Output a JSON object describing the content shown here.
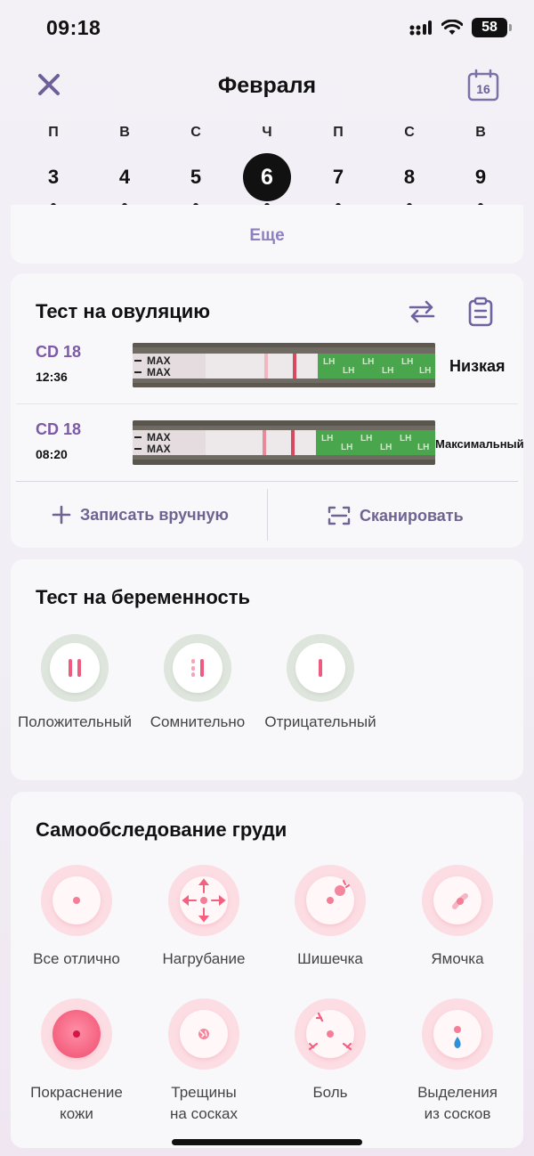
{
  "status_bar": {
    "time": "09:18",
    "battery": "58"
  },
  "header": {
    "month": "Февраля",
    "calendar_day": "16"
  },
  "week": {
    "days": [
      {
        "weekday": "П",
        "date": "3",
        "selected": false
      },
      {
        "weekday": "В",
        "date": "4",
        "selected": false
      },
      {
        "weekday": "С",
        "date": "5",
        "selected": false
      },
      {
        "weekday": "Ч",
        "date": "6",
        "selected": true
      },
      {
        "weekday": "П",
        "date": "7",
        "selected": false
      },
      {
        "weekday": "С",
        "date": "8",
        "selected": false
      },
      {
        "weekday": "В",
        "date": "9",
        "selected": false
      }
    ]
  },
  "more": {
    "label": "Еще"
  },
  "ovulation": {
    "title": "Тест на овуляцию",
    "tests": [
      {
        "cd": "CD 18",
        "time": "12:36",
        "result": "Низкая",
        "strip_text": "MAX"
      },
      {
        "cd": "CD 18",
        "time": "08:20",
        "result": "Максимальный",
        "strip_text": "MAX"
      }
    ],
    "manual_label": "Записать вручную",
    "scan_label": "Сканировать"
  },
  "pregnancy": {
    "title": "Тест на беременность",
    "options": [
      {
        "label": "Положительный",
        "icon": "two-lines-icon"
      },
      {
        "label": "Сомнительно",
        "icon": "faint-line-icon"
      },
      {
        "label": "Отрицательный",
        "icon": "one-line-icon"
      }
    ]
  },
  "breast_exam": {
    "title": "Самообследование груди",
    "options": [
      {
        "line1": "Все отлично",
        "line2": ""
      },
      {
        "line1": "Нагрубание",
        "line2": ""
      },
      {
        "line1": "Шишечка",
        "line2": ""
      },
      {
        "line1": "Ямочка",
        "line2": ""
      },
      {
        "line1": "Покраснение",
        "line2": "кожи"
      },
      {
        "line1": "Трещины",
        "line2": "на сосках"
      },
      {
        "line1": "Боль",
        "line2": ""
      },
      {
        "line1": "Выделения",
        "line2": "из сосков"
      }
    ]
  },
  "colors": {
    "accent": "#7d5aa8",
    "pink": "#ef5a7f",
    "text_secondary": "#444444"
  }
}
